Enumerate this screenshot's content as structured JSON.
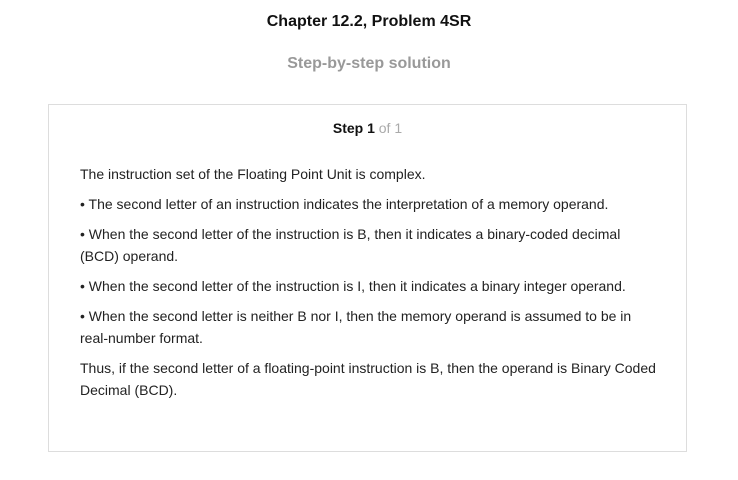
{
  "header": {
    "title": "Chapter 12.2, Problem 4SR",
    "subtitle": "Step-by-step solution"
  },
  "step": {
    "label": "Step 1",
    "of": "of 1",
    "paragraphs": [
      "The instruction set of the Floating Point Unit is complex.",
      "• The second letter of an instruction indicates the interpretation of a memory operand.",
      "• When the second letter of the instruction is B, then it indicates a binary-coded decimal (BCD) operand.",
      "• When the second letter of the instruction is I, then it indicates a binary integer operand.",
      "• When the second letter is neither B nor I, then the memory operand is assumed to be in real-number format.",
      "Thus, if the second letter of a floating-point instruction is B, then the operand is Binary Coded Decimal (BCD)."
    ]
  }
}
